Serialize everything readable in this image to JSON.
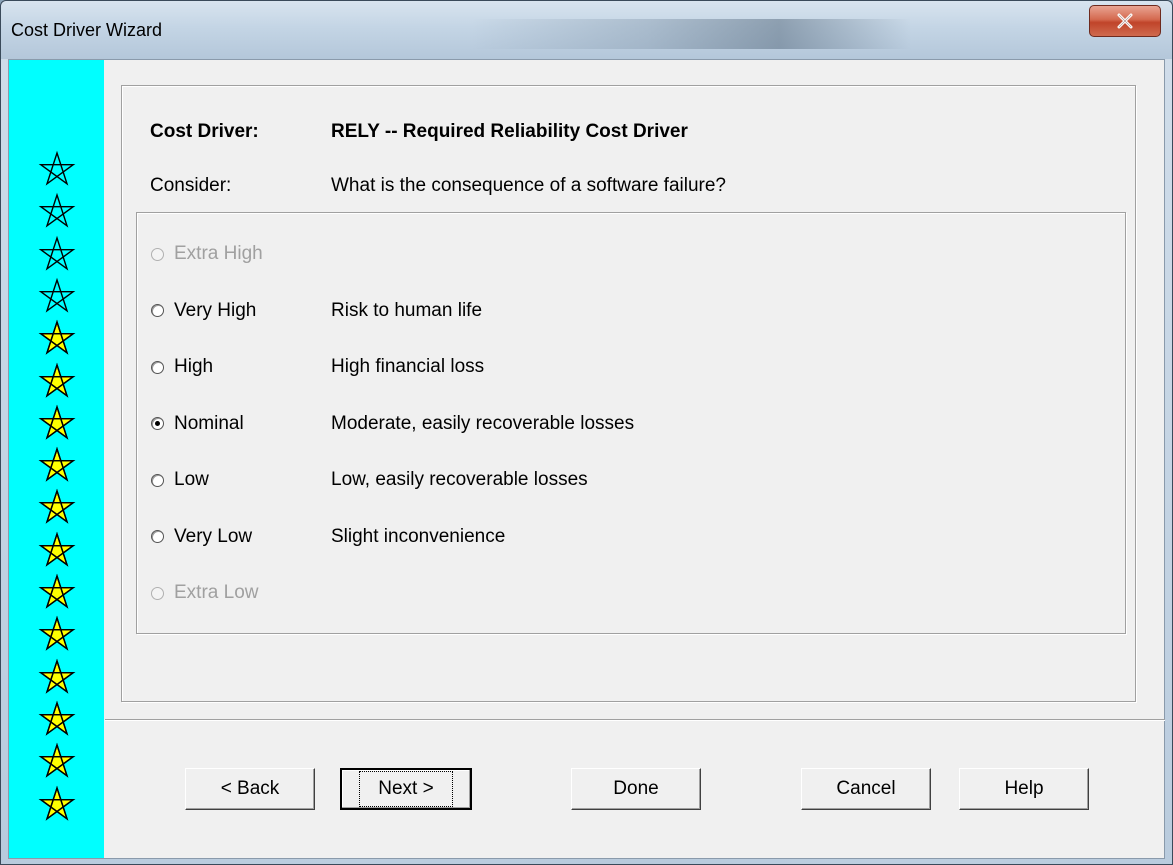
{
  "window": {
    "title": "Cost Driver Wizard",
    "close_label": "x"
  },
  "sidebar": {
    "stars": [
      {
        "type": "outline"
      },
      {
        "type": "outline"
      },
      {
        "type": "outline"
      },
      {
        "type": "outline"
      },
      {
        "type": "filled"
      },
      {
        "type": "filled"
      },
      {
        "type": "filled"
      },
      {
        "type": "filled"
      },
      {
        "type": "filled"
      },
      {
        "type": "filled"
      },
      {
        "type": "filled"
      },
      {
        "type": "filled"
      },
      {
        "type": "filled"
      },
      {
        "type": "filled"
      },
      {
        "type": "filled"
      },
      {
        "type": "filled"
      }
    ],
    "background_color": "#00ffff",
    "star_fill_color": "#ffff00"
  },
  "header": {
    "cost_driver_label": "Cost Driver:",
    "cost_driver_value": "RELY -- Required Reliability Cost Driver",
    "consider_label": "Consider:",
    "consider_value": "What is the consequence of a software failure?"
  },
  "ratings": [
    {
      "label": "Extra High",
      "description": "",
      "enabled": false,
      "checked": false
    },
    {
      "label": "Very High",
      "description": "Risk to human life",
      "enabled": true,
      "checked": false
    },
    {
      "label": "High",
      "description": "High financial loss",
      "enabled": true,
      "checked": false
    },
    {
      "label": "Nominal",
      "description": "Moderate, easily recoverable losses",
      "enabled": true,
      "checked": true
    },
    {
      "label": "Low",
      "description": "Low, easily recoverable losses",
      "enabled": true,
      "checked": false
    },
    {
      "label": "Very Low",
      "description": "Slight inconvenience",
      "enabled": true,
      "checked": false
    },
    {
      "label": "Extra Low",
      "description": "",
      "enabled": false,
      "checked": false
    }
  ],
  "buttons": {
    "back": "< Back",
    "next": "Next >",
    "done": "Done",
    "cancel": "Cancel",
    "help": "Help"
  }
}
